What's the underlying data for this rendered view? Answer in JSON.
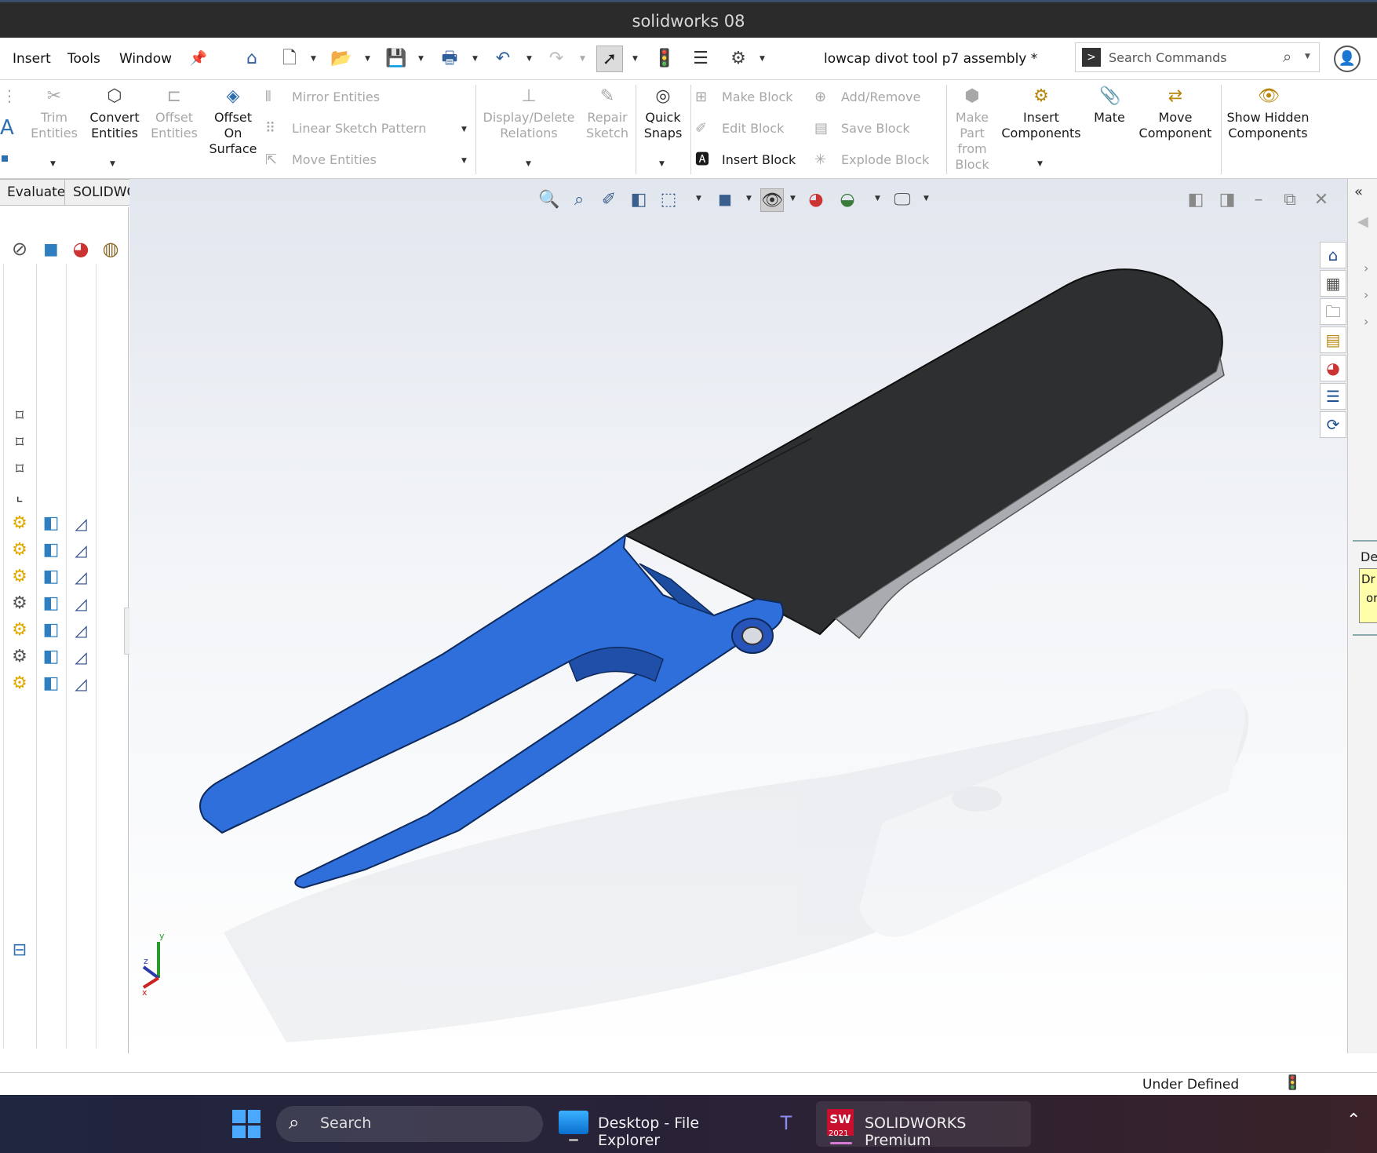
{
  "window": {
    "title": "solidworks 08"
  },
  "menu": {
    "items": [
      "Insert",
      "Tools",
      "Window"
    ]
  },
  "document": {
    "title": "lowcap divot tool p7 assembly *"
  },
  "search": {
    "placeholder": "Search Commands"
  },
  "ribbon": {
    "trim": "Trim Entities",
    "convert": "Convert Entities",
    "offset": "Offset Entities",
    "offset_surface": "Offset On Surface",
    "mirror": "Mirror Entities",
    "linear_pattern": "Linear Sketch Pattern",
    "move_entities": "Move Entities",
    "display_delete": "Display/Delete Relations",
    "repair": "Repair Sketch",
    "quick_snaps": "Quick Snaps",
    "make_block": "Make Block",
    "edit_block": "Edit Block",
    "insert_block": "Insert Block",
    "add_remove": "Add/Remove",
    "save_block": "Save Block",
    "explode_block": "Explode Block",
    "make_part": "Make Part from Block",
    "insert_components": "Insert Components",
    "mate": "Mate",
    "move_component": "Move Component",
    "show_hidden": "Show Hidden Components"
  },
  "tabs": [
    "Evaluate",
    "SOLIDWORKS Add-Ins"
  ],
  "right_panel": {
    "label_1": "De",
    "label_2": "Dr",
    "label_3": "or"
  },
  "status": {
    "text": "Under Defined"
  },
  "taskbar": {
    "search": "Search",
    "apps": [
      "Desktop - File Explorer",
      "SOLIDWORKS Premium"
    ],
    "sw_version": "2021"
  },
  "triad": {
    "x": "x",
    "y": "y",
    "z": "z"
  },
  "colors": {
    "part_blue": "#2f6fdb",
    "grip_dark": "#2e2f31",
    "titlebar": "#2b2b2b"
  }
}
